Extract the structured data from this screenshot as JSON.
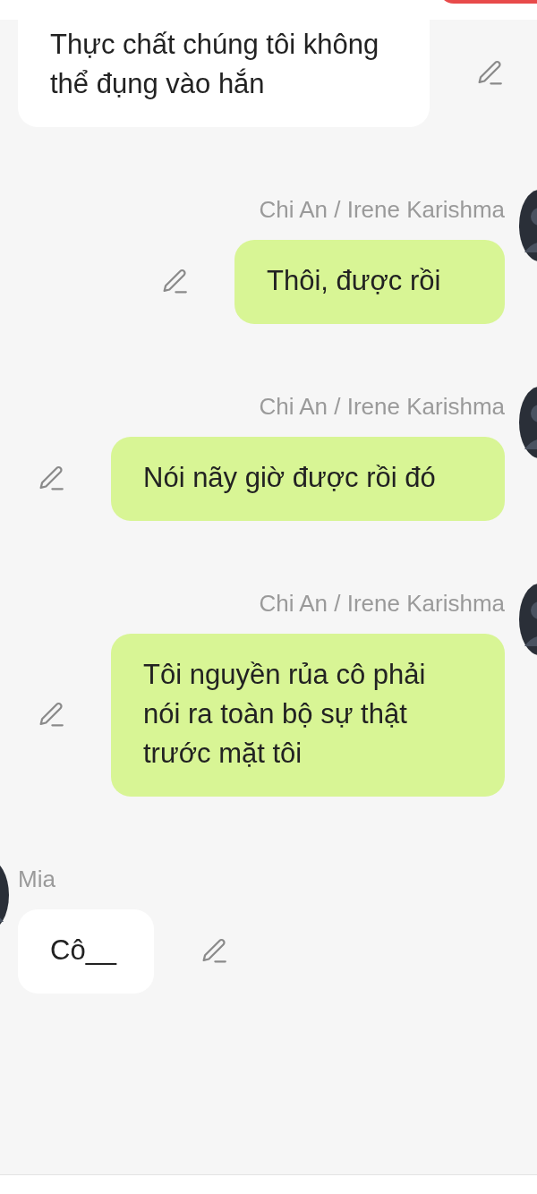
{
  "messages": [
    {
      "kind": "incoming",
      "text": "Thực chất chúng tôi không thể đụng vào hắn"
    },
    {
      "kind": "outgoing",
      "sender": "Chi An / Irene Karishma",
      "text": "Thôi, được rồi"
    },
    {
      "kind": "outgoing",
      "sender": "Chi An / Irene Karishma",
      "text": "Nói nãy giờ được rồi đó"
    },
    {
      "kind": "outgoing",
      "sender": "Chi An / Irene Karishma",
      "text": "Tôi nguyền rủa cô phải nói ra toàn bộ sự thật trước mặt tôi"
    },
    {
      "kind": "incoming",
      "sender": "Mia",
      "text": "Cô__"
    }
  ]
}
